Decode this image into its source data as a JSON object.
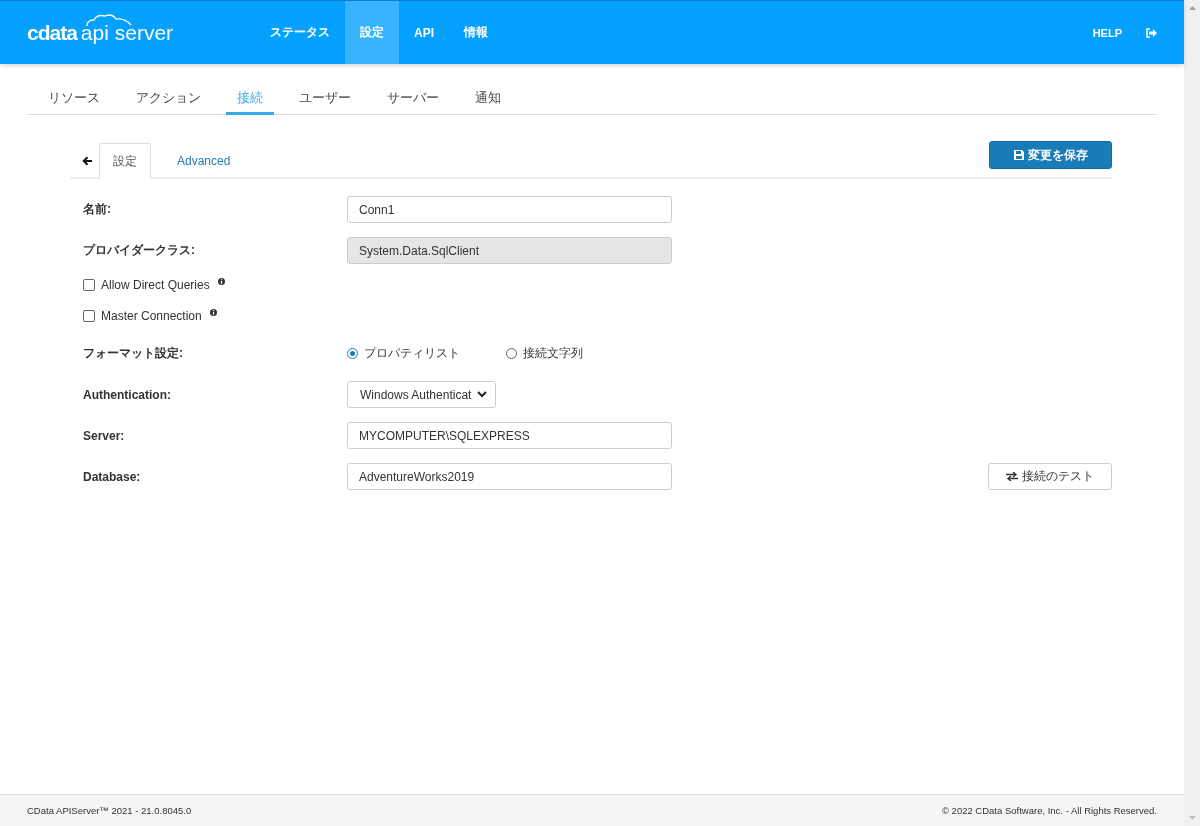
{
  "header": {
    "logo": {
      "brand": "cdata",
      "product": "api server"
    },
    "nav": [
      {
        "label": "ステータス",
        "selected": false
      },
      {
        "label": "設定",
        "selected": true
      },
      {
        "label": "API",
        "selected": false
      },
      {
        "label": "情報",
        "selected": false
      }
    ],
    "help": "HELP"
  },
  "subnav": [
    {
      "label": "リソース",
      "selected": false
    },
    {
      "label": "アクション",
      "selected": false
    },
    {
      "label": "接続",
      "selected": true
    },
    {
      "label": "ユーザー",
      "selected": false
    },
    {
      "label": "サーバー",
      "selected": false
    },
    {
      "label": "通知",
      "selected": false
    }
  ],
  "panel": {
    "tabs": [
      {
        "label": "設定",
        "selected": true
      },
      {
        "label": "Advanced",
        "selected": false
      }
    ],
    "save_button": "変更を保存"
  },
  "fields": [
    {
      "kind": "text",
      "label": "名前:",
      "value": "Conn1",
      "disabled": false
    },
    {
      "kind": "text",
      "label": "プロバイダークラス:",
      "value": "System.Data.SqlClient",
      "disabled": true
    },
    {
      "kind": "checkbox",
      "label": "Allow Direct Queries",
      "checked": false
    },
    {
      "kind": "checkbox",
      "label": "Master Connection",
      "checked": false
    },
    {
      "kind": "radio",
      "label": "フォーマット設定:",
      "options": [
        {
          "label": "プロパティリスト",
          "selected": true
        },
        {
          "label": "接続文字列",
          "selected": false
        }
      ]
    },
    {
      "kind": "select",
      "label": "Authentication:",
      "value": "Windows Authenticat"
    },
    {
      "kind": "text",
      "label": "Server:",
      "value": "MYCOMPUTER\\SQLEXPRESS",
      "disabled": false
    },
    {
      "kind": "text",
      "label": "Database:",
      "value": "AdventureWorks2019",
      "disabled": false,
      "action": "接続のテスト"
    }
  ],
  "footer": {
    "version": "CData APIServer™ 2021 - 21.0.8045.0",
    "copyright": "© 2022 CData Software, Inc. - All Rights Reserved."
  }
}
